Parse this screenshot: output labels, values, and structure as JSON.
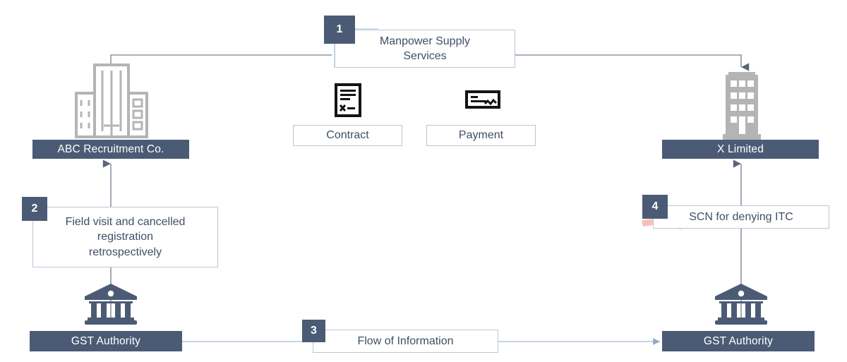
{
  "diagram": {
    "title": "GST Manpower Supply Services ITC Denial Flow",
    "colors": {
      "dark_box": "#4c5b75",
      "badge": "#4c5b75",
      "light_box_border": "#b9c6d8",
      "text_blue": "#3f4f66",
      "connector_gray": "#7e8596",
      "connector_blue": "#9db4d0",
      "building_gray": "#b0b0b0",
      "swoosh_pink": "#f6bfb8",
      "icon_black": "#1a1a1a",
      "canvas": "#ffffff"
    },
    "nodes": {
      "service_box": {
        "label_line1": "Manpower Supply",
        "label_line2": "Services",
        "badge": "1"
      },
      "supplier": {
        "label": "ABC Recruitment Co.",
        "icon": "office-building-icon"
      },
      "recipient": {
        "label": "X Limited",
        "icon": "office-building-icon"
      },
      "contract": {
        "label": "Contract",
        "icon": "contract-document-icon"
      },
      "payment": {
        "label": "Payment",
        "icon": "cheque-icon"
      },
      "field_visit_box": {
        "label_line1": "Field visit and cancelled",
        "label_line2": "registration",
        "label_line3": "retrospectively",
        "badge": "2"
      },
      "scn_box": {
        "label": "SCN for denying ITC",
        "badge": "4"
      },
      "flow_box": {
        "label": "Flow of Information",
        "badge": "3"
      },
      "gst_left": {
        "label": "GST Authority",
        "icon": "government-bank-icon"
      },
      "gst_right": {
        "label": "GST Authority",
        "icon": "government-bank-icon"
      }
    }
  }
}
